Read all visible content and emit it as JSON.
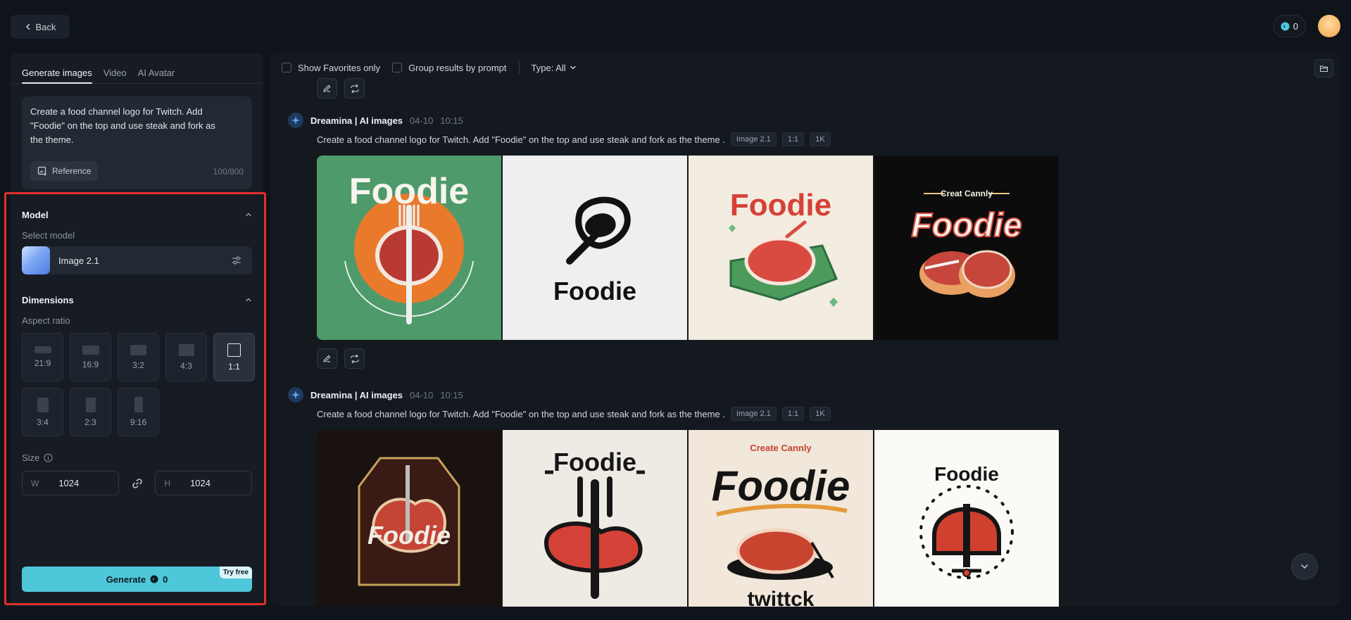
{
  "header": {
    "back_label": "Back",
    "credits": "0"
  },
  "left_panel": {
    "tabs": [
      {
        "label": "Generate images",
        "active": true
      },
      {
        "label": "Video",
        "active": false
      },
      {
        "label": "AI Avatar",
        "active": false
      }
    ],
    "prompt": "Create a food channel logo for Twitch. Add \"Foodie\" on the top and use steak and fork as the theme.",
    "reference_label": "Reference",
    "char_count": "100/800",
    "model_section": {
      "title": "Model",
      "select_label": "Select model",
      "model_name": "Image 2.1"
    },
    "dimensions_section": {
      "title": "Dimensions",
      "aspect_label": "Aspect ratio",
      "ratios": [
        {
          "label": "21:9",
          "active": false
        },
        {
          "label": "16:9",
          "active": false
        },
        {
          "label": "3:2",
          "active": false
        },
        {
          "label": "4:3",
          "active": false
        },
        {
          "label": "1:1",
          "active": true
        },
        {
          "label": "3:4",
          "active": false
        },
        {
          "label": "2:3",
          "active": false
        },
        {
          "label": "9:16",
          "active": false
        }
      ],
      "size_label": "Size",
      "width_prefix": "W",
      "width": "1024",
      "height_prefix": "H",
      "height": "1024"
    },
    "generate_label": "Generate",
    "generate_cost": "0",
    "try_free_label": "Try free"
  },
  "main": {
    "filters": {
      "favorites_label": "Show Favorites only",
      "group_label": "Group results by prompt",
      "type_label": "Type: All"
    },
    "entries": [
      {
        "source": "Dreamina | AI images",
        "date": "04-10",
        "time": "10:15",
        "prompt": "Create a food channel logo for Twitch. Add \"Foodie\" on the top and use steak and fork as the theme .",
        "tags": [
          "Image 2.1",
          "1:1",
          "1K"
        ],
        "images": [
          {
            "text": "Foodie"
          },
          {
            "text": "Foodie"
          },
          {
            "text": "Foodie"
          },
          {
            "text": "Foodie",
            "subtitle": "Creat Cannly"
          }
        ]
      },
      {
        "source": "Dreamina | AI images",
        "date": "04-10",
        "time": "10:15",
        "prompt": "Create a food channel logo for Twitch. Add \"Foodie\" on the top and use steak and fork as the theme .",
        "tags": [
          "Image 2.1",
          "1:1",
          "1K"
        ],
        "images": [
          {
            "text": "Foodie"
          },
          {
            "text": "Foodie"
          },
          {
            "text": "Foodie",
            "subtitle": "Create Cannly",
            "footer": "twittck"
          },
          {
            "text": "Foodie"
          }
        ]
      }
    ]
  },
  "colors": {
    "accent": "#4fc7da",
    "highlight": "#e0302a",
    "background": "#0f131a"
  }
}
